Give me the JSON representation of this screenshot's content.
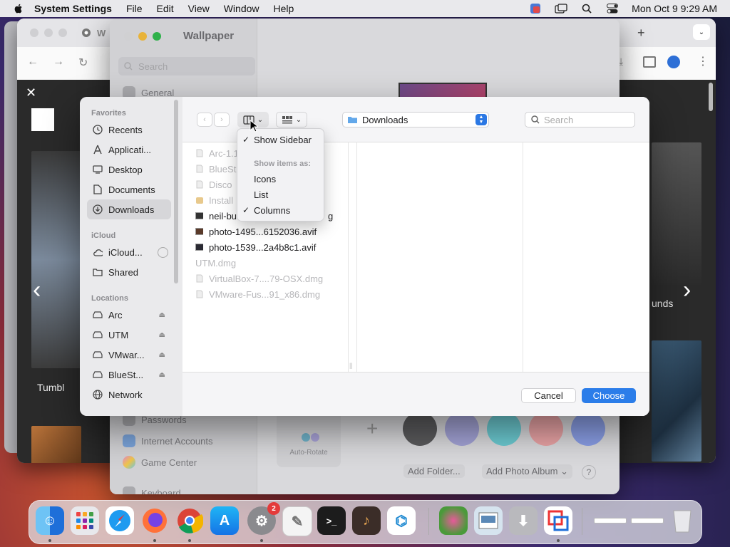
{
  "menubar": {
    "app_name": "System Settings",
    "items": [
      "File",
      "Edit",
      "View",
      "Window",
      "Help"
    ],
    "clock": "Mon Oct 9  9:29 AM",
    "icons": [
      "apple-icon",
      "translate-icon",
      "window-icon",
      "search-icon",
      "control-center-icon"
    ]
  },
  "browser": {
    "tab_initial": "W",
    "carousel_left": "‹",
    "carousel_right": "›",
    "card_text_left": "Tumbl",
    "card_text_right": "unds"
  },
  "settings": {
    "title": "Wallpaper",
    "search_placeholder": "Search",
    "sidebar": {
      "general": "General",
      "passwords": "Passwords",
      "internet_accounts": "Internet Accounts",
      "game_center": "Game Center",
      "keyboard": "Keyboard"
    },
    "auto_rotate": "Auto-Rotate",
    "add_folder": "Add Folder...",
    "add_photo_album": "Add Photo Album",
    "help": "?",
    "swatches": [
      "#5b5b5d",
      "#a3a3d6",
      "#6ccbd2",
      "#e9a3a5",
      "#8a9ee6"
    ]
  },
  "dialog": {
    "sidebar": {
      "favorites_header": "Favorites",
      "favorites": [
        {
          "label": "Recents",
          "icon": "clock-icon"
        },
        {
          "label": "Applicati...",
          "icon": "applications-icon"
        },
        {
          "label": "Desktop",
          "icon": "desktop-icon"
        },
        {
          "label": "Documents",
          "icon": "document-icon"
        },
        {
          "label": "Downloads",
          "icon": "download-icon"
        }
      ],
      "icloud_header": "iCloud",
      "icloud": [
        {
          "label": "iCloud...",
          "icon": "cloud-icon"
        },
        {
          "label": "Shared",
          "icon": "shared-folder-icon"
        }
      ],
      "locations_header": "Locations",
      "locations": [
        {
          "label": "Arc",
          "icon": "drive-icon"
        },
        {
          "label": "UTM",
          "icon": "drive-icon"
        },
        {
          "label": "VMwar...",
          "icon": "drive-icon"
        },
        {
          "label": "BlueSt...",
          "icon": "drive-icon"
        },
        {
          "label": "Network",
          "icon": "network-icon"
        }
      ]
    },
    "toolbar": {
      "back": "‹",
      "forward": "›",
      "location": "Downloads",
      "search_placeholder": "Search"
    },
    "files": [
      {
        "name": "Arc-1.1",
        "dim": true
      },
      {
        "name": "BlueSt",
        "dim": true
      },
      {
        "name": "Disco",
        "dim": true
      },
      {
        "name": "Install",
        "dim": true
      },
      {
        "name": "neil-bu",
        "dim": false,
        "tail": "g"
      },
      {
        "name": "photo-1495...6152036.avif",
        "dim": false
      },
      {
        "name": "photo-1539...2a4b8c1.avif",
        "dim": false
      },
      {
        "name": "UTM.dmg",
        "dim": true
      },
      {
        "name": "VirtualBox-7....79-OSX.dmg",
        "dim": true
      },
      {
        "name": "VMware-Fus...91_x86.dmg",
        "dim": true
      }
    ],
    "cancel": "Cancel",
    "choose": "Choose"
  },
  "view_menu": {
    "show_sidebar": "Show Sidebar",
    "show_items_as": "Show items as:",
    "icons": "Icons",
    "list": "List",
    "columns": "Columns",
    "checkmark": "✓"
  },
  "dock": {
    "apps": [
      "Finder",
      "Launchpad",
      "Safari",
      "Firefox",
      "Chrome",
      "App Store",
      "System Settings",
      "TextEdit",
      "Terminal",
      "GarageBand",
      "VS Code",
      "Preview",
      "Image Capture",
      "Installer",
      "Parallels",
      "Trash"
    ],
    "settings_badge": "2"
  }
}
